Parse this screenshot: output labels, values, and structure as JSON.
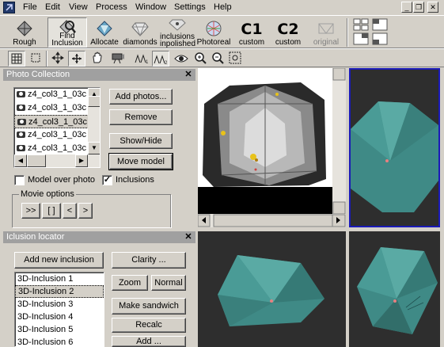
{
  "menu": [
    "File",
    "Edit",
    "View",
    "Process",
    "Window",
    "Settings",
    "Help"
  ],
  "window_controls": {
    "minimize": "_",
    "restore": "❐",
    "close": "✕"
  },
  "toolbar": {
    "rough": "Rough",
    "find_inclusion": "Find\nInclusion",
    "allocate": "Allocate",
    "diamonds": "diamonds",
    "inclusions_inpolished": "inclusions\ninpolished",
    "photoreal": "Photoreal",
    "c1_big": "C1",
    "c1_label": "custom",
    "c2_big": "C2",
    "c2_label": "custom",
    "original": "original"
  },
  "photo_panel": {
    "title": "Photo Collection",
    "photos": [
      "z4_col3_1_03c",
      "z4_col3_1_03c",
      "z4_col3_1_03c",
      "z4_col3_1_03c",
      "z4_col3_1_03c"
    ],
    "add_photos": "Add photos...",
    "remove": "Remove",
    "show_hide": "Show/Hide",
    "move_model": "Move model",
    "model_over_photo": "Model over photo",
    "inclusions": "Inclusions",
    "movie_options": "Movie options",
    "movie_buttons": [
      ">>",
      "[ ]",
      "<",
      ">"
    ]
  },
  "inclusion_panel": {
    "title": "Iclusion locator",
    "add_new": "Add new inclusion",
    "clarity": "Clarity ...",
    "zoom": "Zoom",
    "normal": "Normal",
    "make_sandwich": "Make sandwich",
    "recalc": "Recalc",
    "add_more": "Add ...",
    "items": [
      "3D-Inclusion 1",
      "3D-Inclusion 2",
      "3D-Inclusion 3",
      "3D-Inclusion 4",
      "3D-Inclusion 5",
      "3D-Inclusion 6"
    ]
  },
  "colors": {
    "model_teal": "#4a9b96",
    "viewport_bg": "#2e2e2e",
    "selection_border": "#1a1ab8",
    "inclusion_yellow": "#e8c21a"
  }
}
